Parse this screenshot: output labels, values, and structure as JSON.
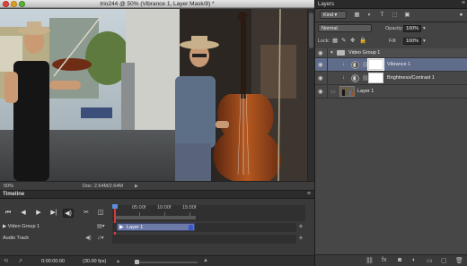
{
  "document": {
    "title": "trio244 @ 50% (Vibrance 1, Layer Mask/8) *",
    "zoom": "50%",
    "doc_size": "Doc: 2.64M/2.64M"
  },
  "timeline": {
    "title": "Timeline",
    "ruler": [
      "05:00f",
      "10:00f",
      "15:00f"
    ],
    "rows": {
      "group": "Video Group 1",
      "audio": "Audio Track"
    },
    "clip_label": "Layer 1",
    "current_time": "0:00:00:00",
    "fps": "(30.00 fps)"
  },
  "layers": {
    "title": "Layers",
    "filter_kind": "Kind",
    "blend_mode": "Normal",
    "opacity_label": "Opacity:",
    "opacity_value": "100%",
    "lock_label": "Lock:",
    "fill_label": "Fill:",
    "fill_value": "100%",
    "items": [
      {
        "name": "Video Group 1",
        "type": "group"
      },
      {
        "name": "Vibrance 1",
        "type": "adjustment",
        "selected": true
      },
      {
        "name": "Brightness/Contrast 1",
        "type": "adjustment",
        "selected": false
      },
      {
        "name": "Layer 1",
        "type": "pixel"
      }
    ]
  },
  "icons": {
    "eye": "eye-icon",
    "folder": "folder-icon",
    "link": "link-icon",
    "fx": "fx-icon",
    "mask": "mask-icon",
    "new_adjustment": "adjustment-icon",
    "new_group": "folder-icon",
    "new_layer": "new-layer-icon",
    "trash": "trash-icon"
  },
  "colors": {
    "selection_highlight": "#5f6c8a",
    "clip_color": "#6d7aa8",
    "playhead": "#d23b3b"
  }
}
